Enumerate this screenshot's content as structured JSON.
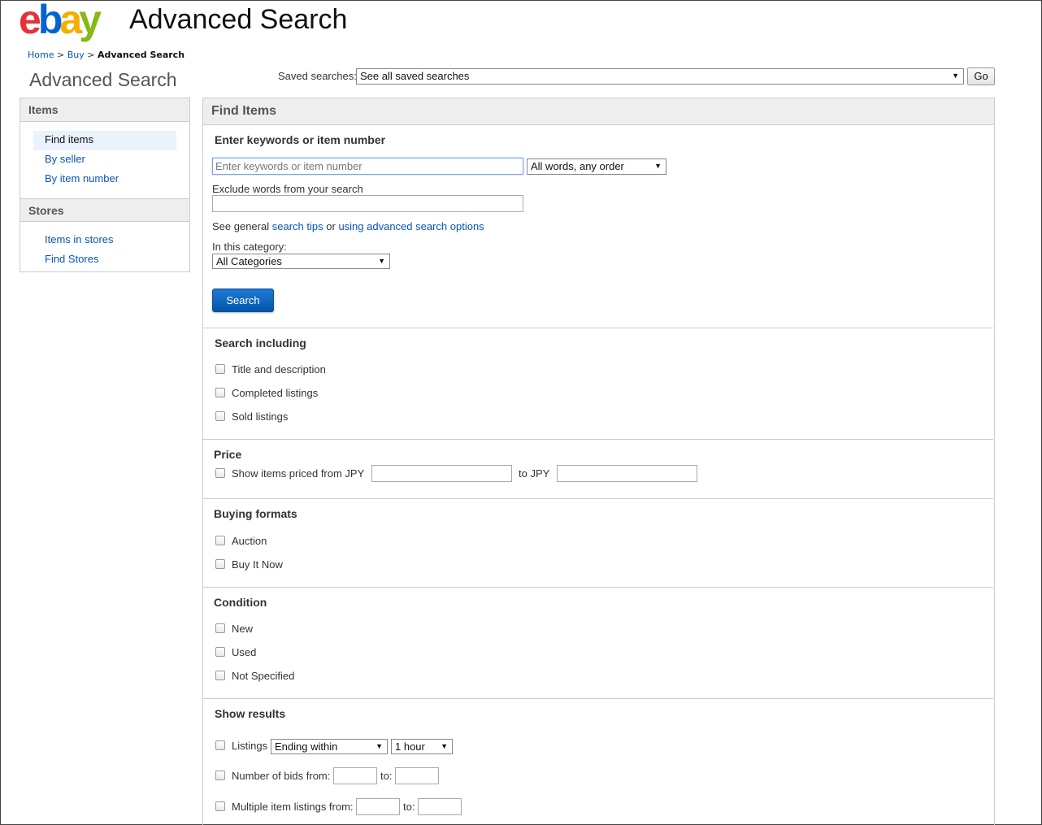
{
  "header": {
    "logo": {
      "e": "e",
      "b": "b",
      "a": "a",
      "y": "y"
    },
    "title": "Advanced Search"
  },
  "breadcrumb": {
    "home": "Home",
    "sep1": ">",
    "buy": "Buy",
    "sep2": ">",
    "current": "Advanced Search"
  },
  "page_title": "Advanced Search",
  "saved_searches": {
    "label": "Saved searches:",
    "selected": "See all saved searches",
    "go": "Go"
  },
  "sidebar": {
    "items_head": "Items",
    "items": [
      "Find items",
      "By seller",
      "By item number"
    ],
    "stores_head": "Stores",
    "stores": [
      "Items in stores",
      "Find Stores"
    ]
  },
  "main": {
    "head": "Find Items",
    "keywords": {
      "title": "Enter keywords or item number",
      "placeholder": "Enter keywords or item number",
      "order_selected": "All words, any order",
      "exclude_label": "Exclude words from your search",
      "tips_prefix": "See general",
      "tips_link": "search tips",
      "tips_or": "or",
      "tips_link2": "using advanced search options",
      "category_label": "In this category:",
      "category_selected": "All Categories",
      "search_button": "Search"
    },
    "search_including": {
      "title": "Search including",
      "options": [
        "Title and description",
        "Completed listings",
        "Sold listings"
      ]
    },
    "price": {
      "title": "Price",
      "from_label": "Show items priced from JPY",
      "to_label": "to JPY"
    },
    "buying_formats": {
      "title": "Buying formats",
      "options": [
        "Auction",
        "Buy It Now"
      ]
    },
    "condition": {
      "title": "Condition",
      "options": [
        "New",
        "Used",
        "Not Specified"
      ]
    },
    "show_results": {
      "title": "Show results",
      "listings_label": "Listings",
      "listings_selected": "Ending within",
      "time_selected": "1 hour",
      "bids_label": "Number of bids from:",
      "bids_to": "to:",
      "multi_label": "Multiple item listings from:",
      "multi_to": "to:"
    }
  }
}
